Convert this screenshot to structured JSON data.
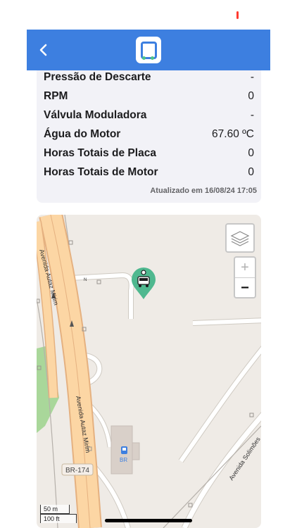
{
  "header": {
    "back_icon": "chevron-left-icon",
    "logo_icon": "app-logo-icon",
    "color": "#3d7fe0"
  },
  "metrics": [
    {
      "label": "Pressão de Descarte",
      "value": "-"
    },
    {
      "label": "RPM",
      "value": "0"
    },
    {
      "label": "Válvula Moduladora",
      "value": "-"
    },
    {
      "label": "Água do Motor",
      "value": "67.60 ºC"
    },
    {
      "label": "Horas Totais de Placa",
      "value": "0"
    },
    {
      "label": "Horas Totais de Motor",
      "value": "0"
    }
  ],
  "updated_text": "Atualizado em 16/08/24 17:05",
  "map": {
    "streets": {
      "autaz_mirim_top": "Avenida Autaz Mirim",
      "autaz_mirim_bottom": "Avenida Autaz Mirim",
      "solimoes": "Avenida Solimões",
      "north_arrow": "N"
    },
    "highway_badge": "BR-174",
    "poi_fuel": "BR",
    "marker_icon": "vehicle-marker-icon",
    "zoom_in": "+",
    "zoom_out": "−",
    "scale_metric": "50 m",
    "scale_imperial": "100 ft"
  }
}
